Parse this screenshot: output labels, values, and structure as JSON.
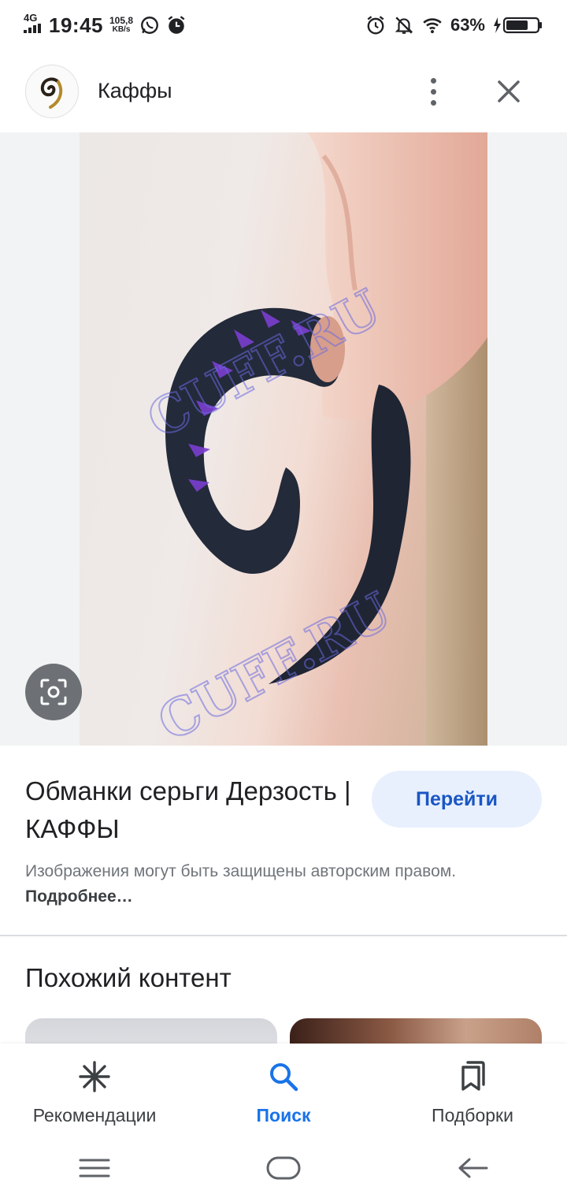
{
  "status_bar": {
    "network": "4G",
    "time": "19:45",
    "speed_value": "105,8",
    "speed_unit": "KB/s",
    "battery_percent": "63%"
  },
  "header": {
    "title": "Каффы",
    "logo_icon": "ear-cuff-logo"
  },
  "image": {
    "watermark": "CUFF.RU"
  },
  "result": {
    "title": "Обманки серьги Дерзость | КАФФЫ",
    "goto_label": "Перейти",
    "copyright_text": "Изображения могут быть защищены авторским правом.",
    "more_link": "Подробнее…"
  },
  "similar": {
    "title": "Похожий контент"
  },
  "bottom_nav": {
    "items": [
      {
        "label": "Рекомендации",
        "icon": "asterisk-icon",
        "active": false
      },
      {
        "label": "Поиск",
        "icon": "search-icon",
        "active": true
      },
      {
        "label": "Подборки",
        "icon": "collections-icon",
        "active": false
      }
    ]
  },
  "colors": {
    "accent": "#1a73e8",
    "button_bg": "#e8f0fe",
    "cuff_dark": "#1f2533",
    "cuff_accent": "#7b3fd0"
  }
}
